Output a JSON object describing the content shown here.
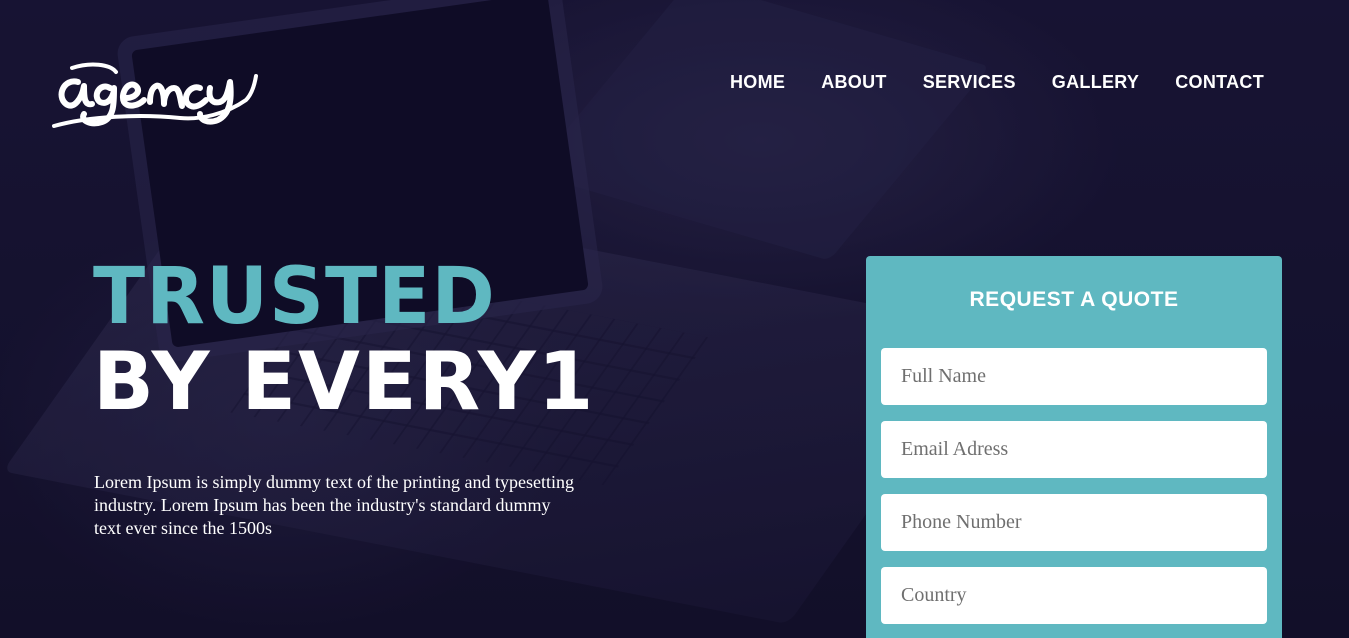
{
  "logo": {
    "text": "agency"
  },
  "nav": {
    "items": [
      {
        "label": "HOME"
      },
      {
        "label": "ABOUT"
      },
      {
        "label": "SERVICES"
      },
      {
        "label": "GALLERY"
      },
      {
        "label": "CONTACT"
      }
    ]
  },
  "hero": {
    "headline_line1": "TRUSTED",
    "headline_line2": "BY EVERY1",
    "description": "Lorem Ipsum is simply dummy text of the printing and typesetting industry. Lorem Ipsum has been the industry's standard dummy text ever since the 1500s"
  },
  "quote_form": {
    "title": "REQUEST A QUOTE",
    "full_name_placeholder": "Full Name",
    "email_placeholder": "Email Adress",
    "phone_placeholder": "Phone Number",
    "country_placeholder": "Country"
  },
  "colors": {
    "background": "#14112e",
    "accent": "#5fb8c1",
    "text": "#ffffff"
  }
}
